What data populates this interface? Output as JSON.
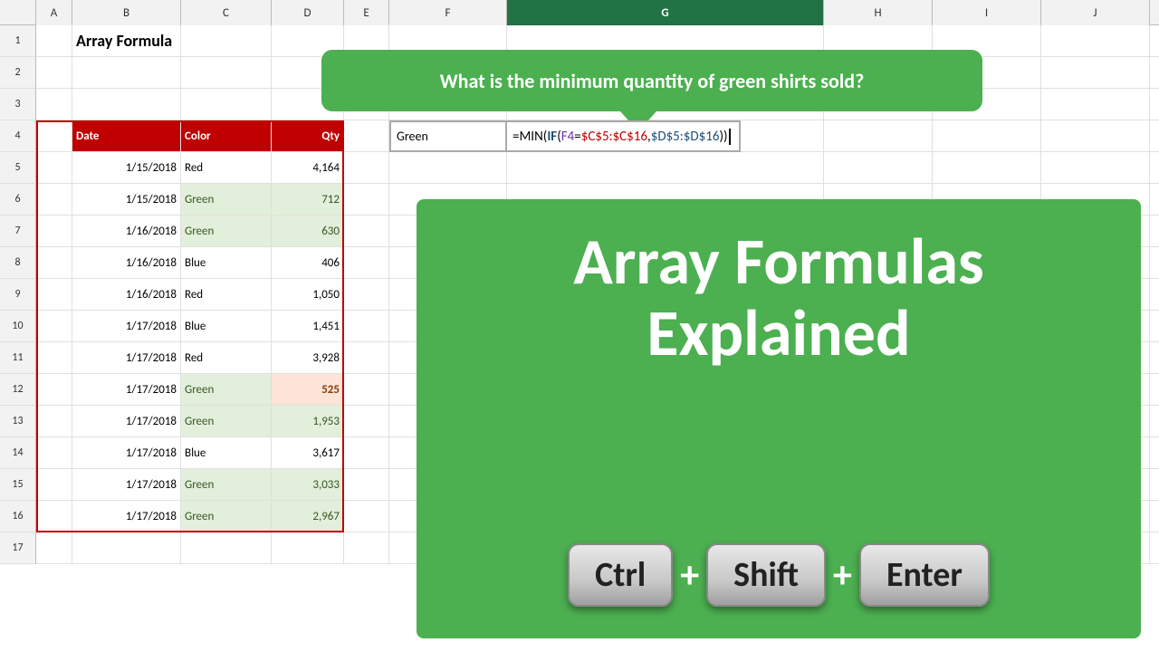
{
  "title": "Array Formula",
  "columns": [
    {
      "label": "",
      "cls": "c-A"
    },
    {
      "label": "B",
      "cls": "c-B"
    },
    {
      "label": "C",
      "cls": "c-C",
      "selected": false
    },
    {
      "label": "D",
      "cls": "c-D",
      "selected": false
    },
    {
      "label": "E",
      "cls": "c-E"
    },
    {
      "label": "F",
      "cls": "c-F"
    },
    {
      "label": "G",
      "cls": "c-G",
      "selected": true
    },
    {
      "label": "H",
      "cls": "c-H"
    },
    {
      "label": "I",
      "cls": "c-I"
    },
    {
      "label": "J",
      "cls": "c-J"
    }
  ],
  "row_numbers": [
    1,
    2,
    3,
    4,
    5,
    6,
    7,
    8,
    9,
    10,
    11,
    12,
    13,
    14,
    15,
    16,
    17
  ],
  "table_headers": {
    "date": "Date",
    "color": "Color",
    "qty": "Qty"
  },
  "rows": [
    {
      "date": "1/15/2018",
      "color": "Red",
      "qty": "4,164",
      "green": false,
      "min": false
    },
    {
      "date": "1/15/2018",
      "color": "Green",
      "qty": "712",
      "green": true,
      "min": false
    },
    {
      "date": "1/16/2018",
      "color": "Green",
      "qty": "630",
      "green": true,
      "min": false
    },
    {
      "date": "1/16/2018",
      "color": "Blue",
      "qty": "406",
      "green": false,
      "min": false
    },
    {
      "date": "1/16/2018",
      "color": "Red",
      "qty": "1,050",
      "green": false,
      "min": false
    },
    {
      "date": "1/17/2018",
      "color": "Blue",
      "qty": "1,451",
      "green": false,
      "min": false
    },
    {
      "date": "1/17/2018",
      "color": "Red",
      "qty": "3,928",
      "green": false,
      "min": false
    },
    {
      "date": "1/17/2018",
      "color": "Green",
      "qty": "525",
      "green": true,
      "min": true
    },
    {
      "date": "1/17/2018",
      "color": "Green",
      "qty": "1,953",
      "green": true,
      "min": false
    },
    {
      "date": "1/17/2018",
      "color": "Blue",
      "qty": "3,617",
      "green": false,
      "min": false
    },
    {
      "date": "1/17/2018",
      "color": "Green",
      "qty": "3,033",
      "green": true,
      "min": false
    },
    {
      "date": "1/17/2018",
      "color": "Green",
      "qty": "2,967",
      "green": true,
      "min": false
    }
  ],
  "callout": {
    "text": "What is the minimum quantity of green shirts sold?"
  },
  "formula": {
    "input": "Green",
    "expression": "=MIN(IF(F4=$C$5:$C$16,$D$5:$D$16))"
  },
  "overlay": {
    "line1": "Array Formulas",
    "line2": "Explained",
    "key1": "Ctrl",
    "key2": "Shift",
    "key3": "Enter",
    "plus": "+"
  }
}
